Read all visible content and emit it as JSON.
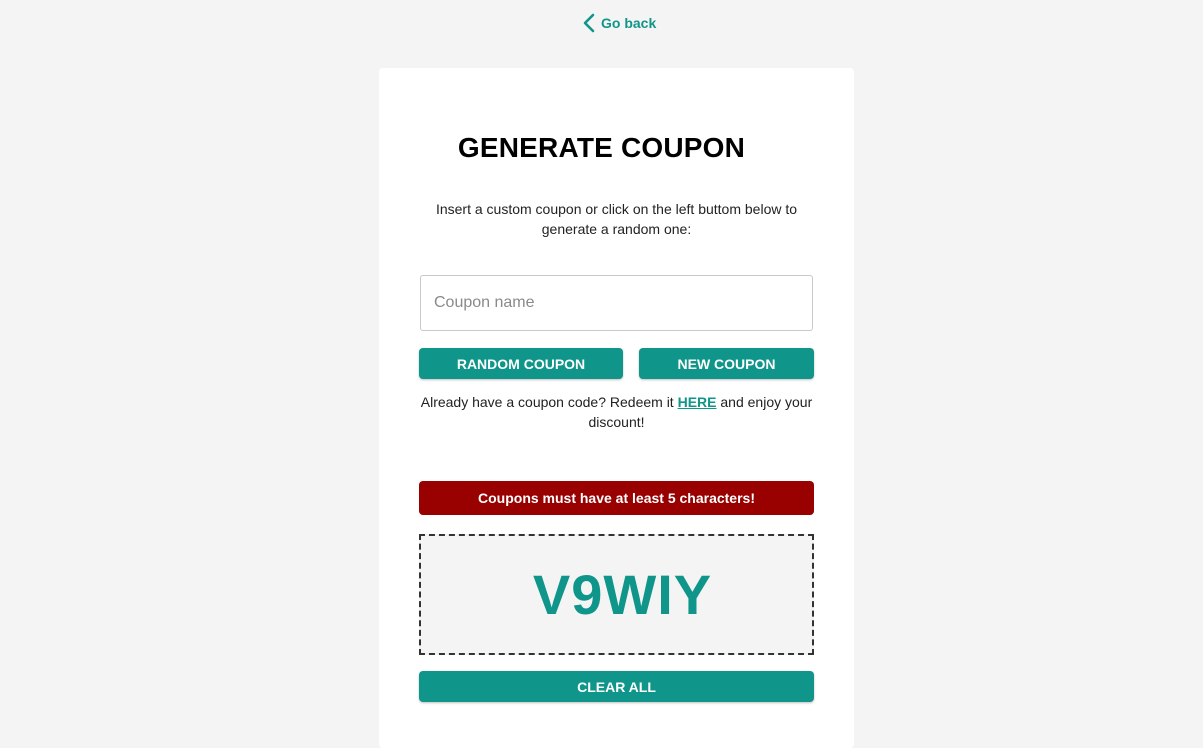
{
  "nav": {
    "go_back_label": "Go back",
    "go_back_icon": "chevron-left-icon"
  },
  "card": {
    "title": "GENERATE COUPON",
    "subtitle": "Insert a custom coupon or click on the left buttom below to generate a random one:",
    "coupon_input": {
      "placeholder": "Coupon name",
      "value": ""
    },
    "random_coupon_label": "RANDOM COUPON",
    "new_coupon_label": "NEW COUPON",
    "redeem": {
      "text_before": "Already have a coupon code? Redeem it ",
      "link_label": "HERE",
      "text_after": " and enjoy your discount!"
    },
    "error_message": "Coupons must have at least 5 characters!",
    "generated_coupon": "V9WIY",
    "clear_all_label": "CLEAR ALL"
  },
  "colors": {
    "accent": "#0f958a",
    "error": "#990000",
    "background": "#f4f4f4",
    "card": "#ffffff"
  }
}
